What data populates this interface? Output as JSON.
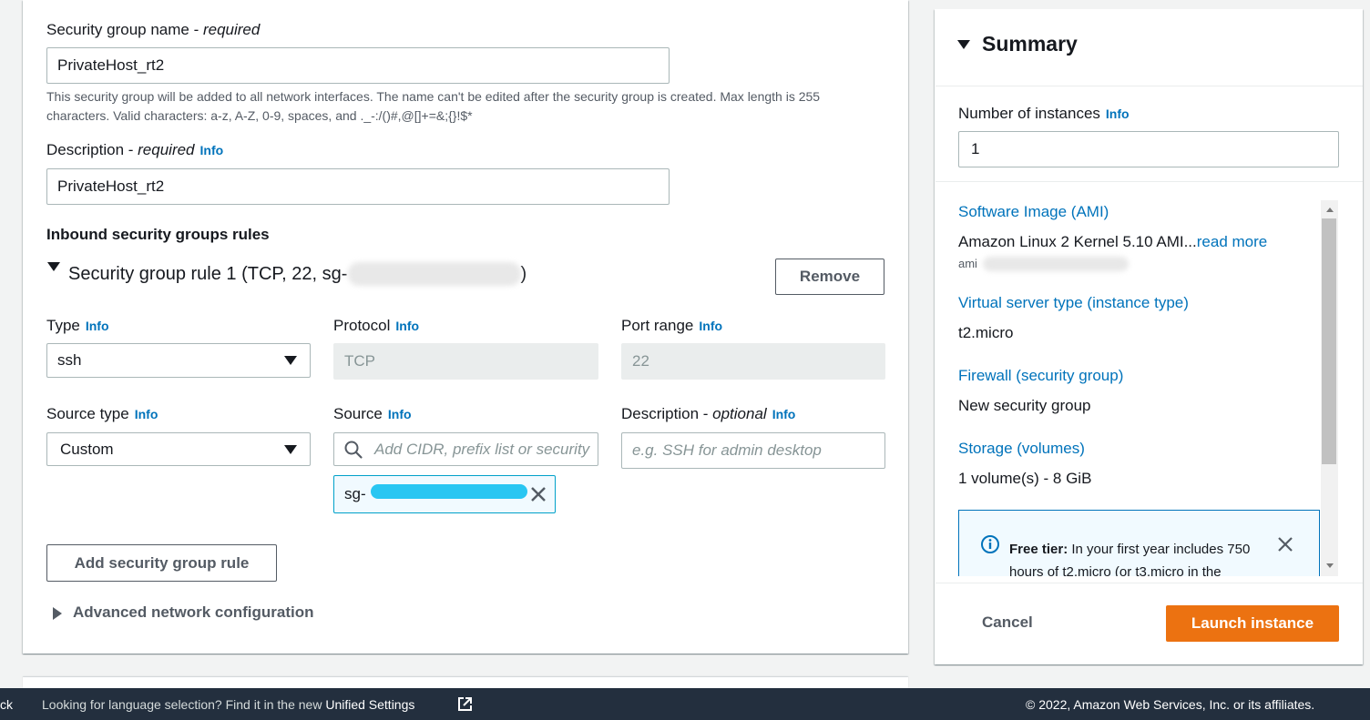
{
  "form": {
    "sg_name": {
      "label": "Security group name - ",
      "label_em": "required",
      "value": "PrivateHost_rt2",
      "hint": "This security group will be added to all network interfaces. The name can't be edited after the security group is created. Max length is 255 characters. Valid characters: a-z, A-Z, 0-9, spaces, and ._-:/()#,@[]+=&;{}!$*"
    },
    "description": {
      "label": "Description - ",
      "label_em": "required",
      "info": "Info",
      "value": "PrivateHost_rt2"
    },
    "inbound_title": "Inbound security groups rules",
    "rule": {
      "title": "Security group rule 1 (TCP, 22, sg-",
      "title_end": ")",
      "remove": "Remove",
      "type": {
        "label": "Type",
        "info": "Info",
        "value": "ssh"
      },
      "protocol": {
        "label": "Protocol",
        "info": "Info",
        "value": "TCP"
      },
      "port_range": {
        "label": "Port range",
        "info": "Info",
        "value": "22"
      },
      "source_type": {
        "label": "Source type",
        "info": "Info",
        "value": "Custom"
      },
      "source": {
        "label": "Source",
        "info": "Info",
        "placeholder": "Add CIDR, prefix list or security",
        "token": "sg-"
      },
      "rule_description": {
        "label": "Description - ",
        "label_em": "optional",
        "info": "Info",
        "placeholder": "e.g. SSH for admin desktop"
      }
    },
    "add_rule": "Add security group rule",
    "advanced": "Advanced network configuration"
  },
  "summary": {
    "title": "Summary",
    "instances": {
      "label": "Number of instances",
      "info": "Info",
      "value": "1"
    },
    "ami": {
      "label": "Software Image (AMI)",
      "value": "Amazon Linux 2 Kernel 5.10 AMI...",
      "read_more": "read more",
      "id_prefix": "ami"
    },
    "instance_type": {
      "label": "Virtual server type (instance type)",
      "value": "t2.micro"
    },
    "firewall": {
      "label": "Firewall (security group)",
      "value": "New security group"
    },
    "storage": {
      "label": "Storage (volumes)",
      "value": "1 volume(s) - 8 GiB"
    },
    "free_tier": {
      "title": "Free tier:",
      "line1": " In your first year includes 750",
      "line2": "hours of t2.micro (or t3.micro in the"
    },
    "cancel": "Cancel",
    "launch": "Launch instance"
  },
  "footer": {
    "left_fragment": "ck",
    "language_text": "Looking for language selection? Find it in the new ",
    "unified_settings": "Unified Settings",
    "copyright": "© 2022, Amazon Web Services, Inc. or its affiliates."
  },
  "colors": {
    "accent": "#0073bb",
    "primary_button": "#ec7211",
    "footer_bg": "#232f3e",
    "token_border": "#00a1c9"
  }
}
